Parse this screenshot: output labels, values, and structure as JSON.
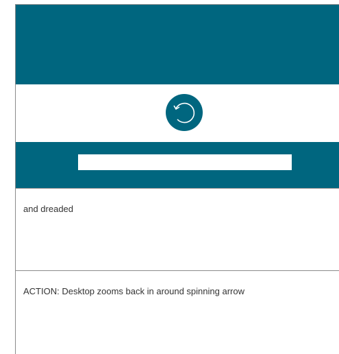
{
  "colors": {
    "accent": "#00667f",
    "background": "#ffffff",
    "border": "#8a8a8a"
  },
  "screen": {
    "spinner_icon": "spinning-arrow-icon",
    "progress_bar_fill": 1.0
  },
  "captions": {
    "first": "and dreaded",
    "second": "ACTION: Desktop zooms back in around spinning arrow"
  }
}
